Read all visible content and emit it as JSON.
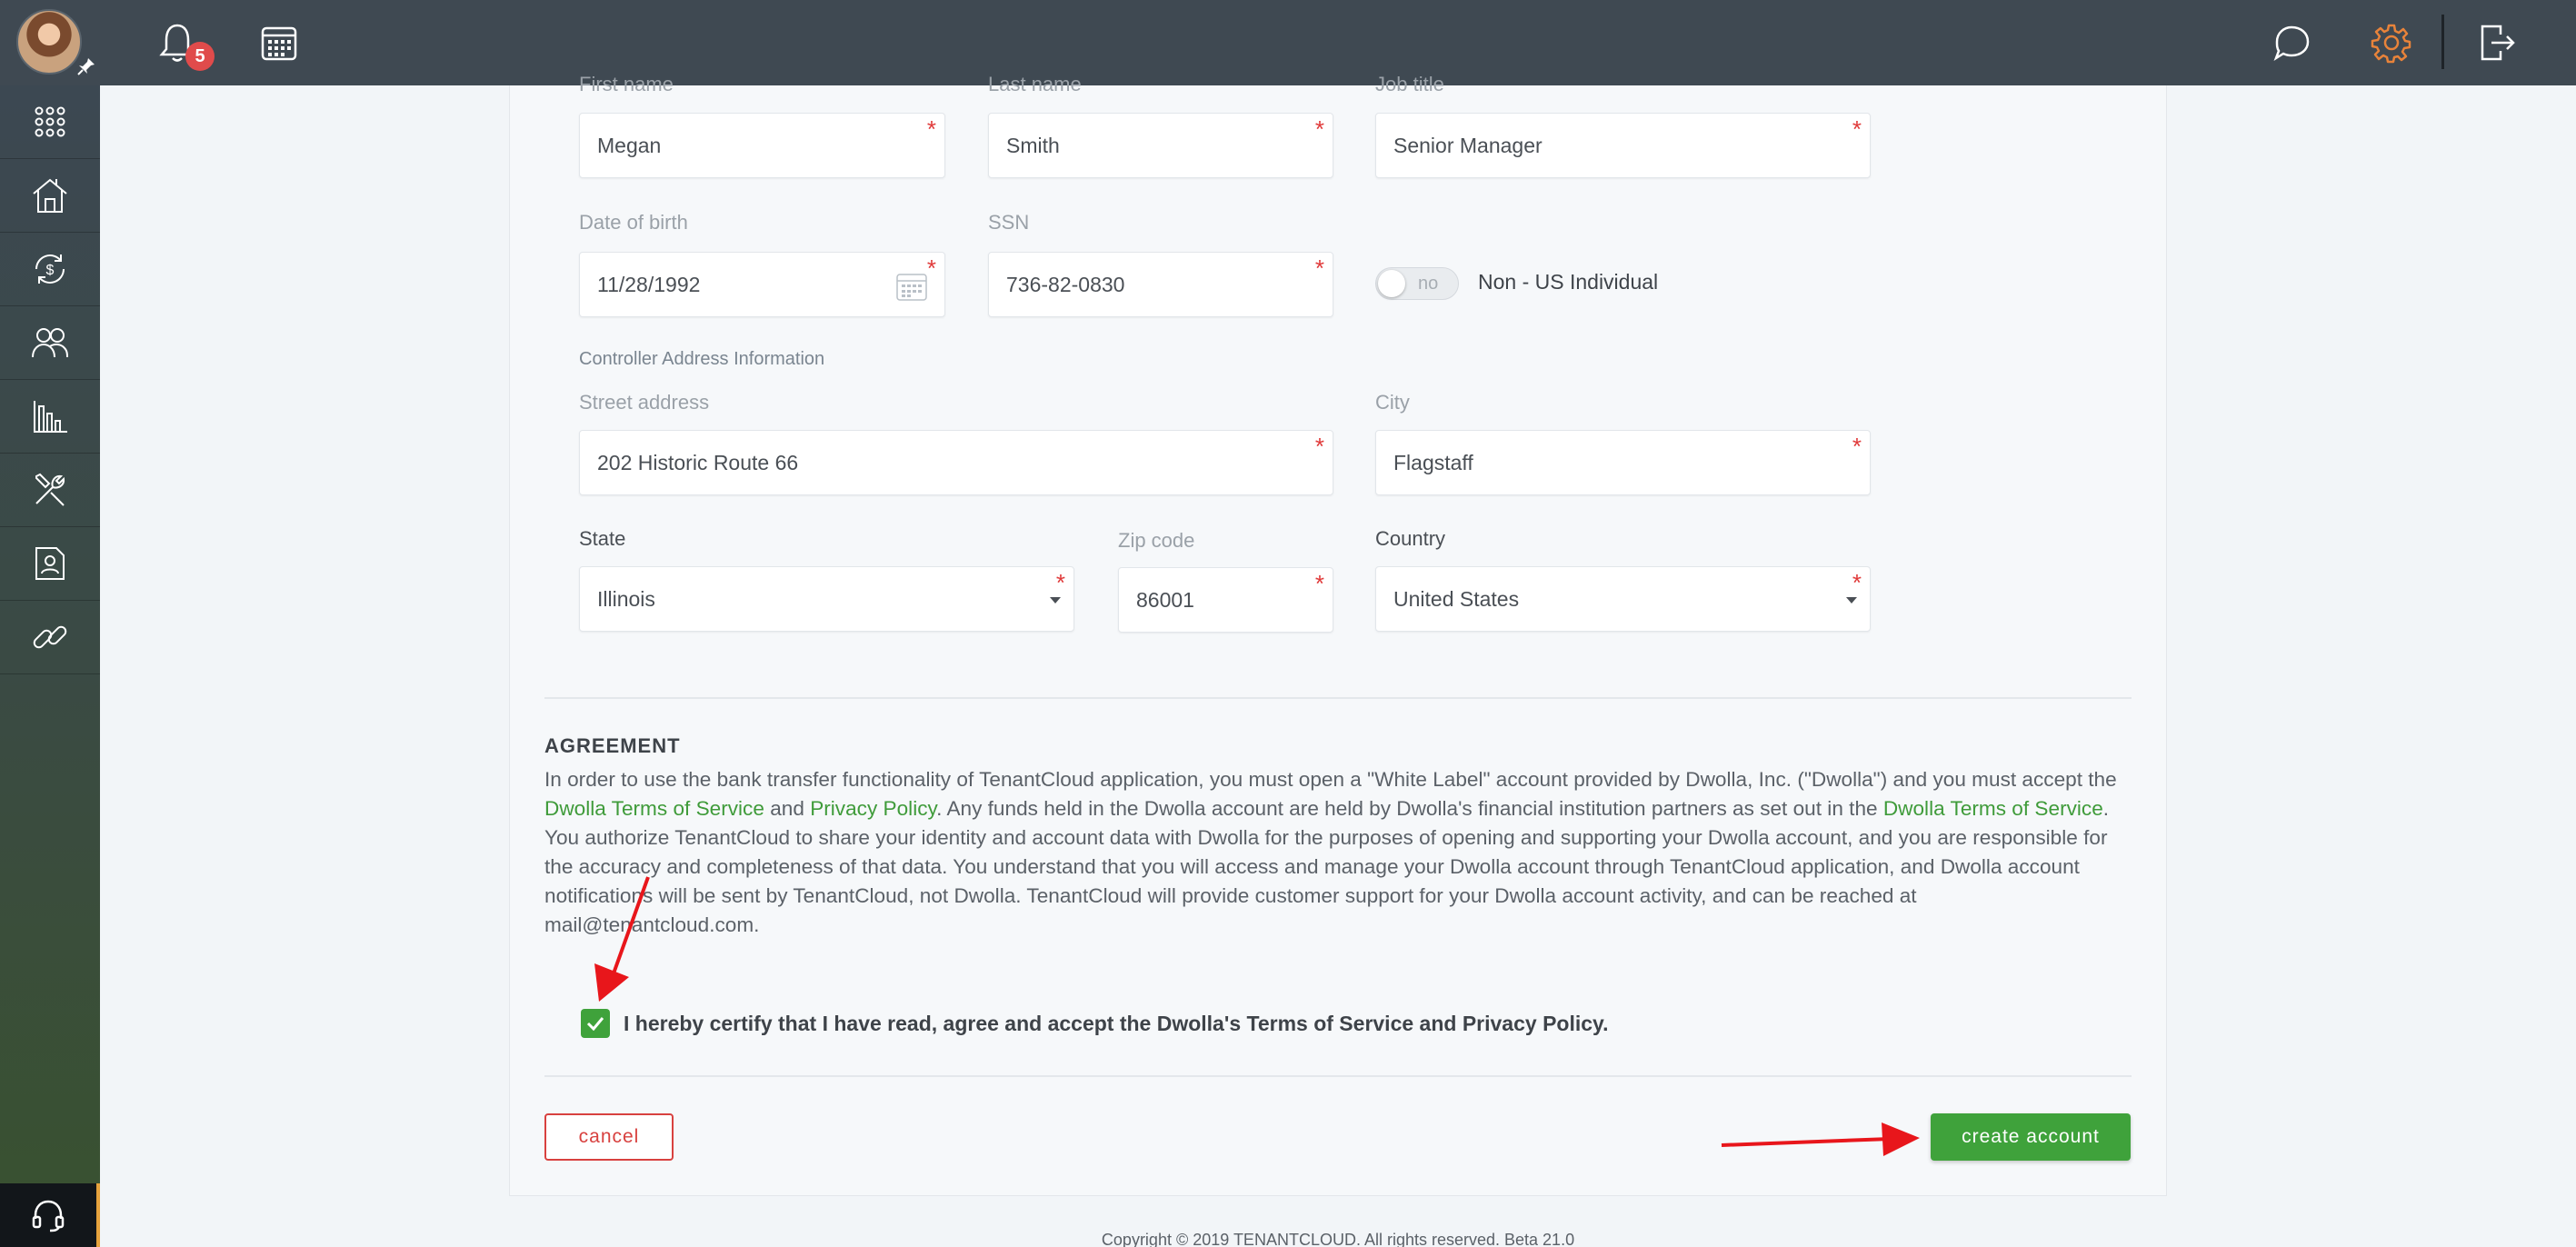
{
  "topbar": {
    "notification_count": "5",
    "icons": [
      "bell-icon",
      "calendar-icon",
      "chat-icon",
      "gear-icon",
      "logout-icon"
    ]
  },
  "sidebar": {
    "items": [
      "apps-icon",
      "properties-icon",
      "payments-icon",
      "people-icon",
      "reports-icon",
      "tools-icon",
      "documents-icon",
      "link-icon"
    ],
    "support_icon": "headset-icon"
  },
  "form": {
    "first_name": {
      "label": "First name",
      "value": "Megan"
    },
    "last_name": {
      "label": "Last name",
      "value": "Smith"
    },
    "job_title": {
      "label": "Job title",
      "value": "Senior Manager"
    },
    "dob": {
      "label": "Date of birth",
      "value": "11/28/1992"
    },
    "ssn": {
      "label": "SSN",
      "value": "736-82-0830"
    },
    "non_us": {
      "toggle_text": "no",
      "label": "Non - US Individual"
    },
    "section_title": "Controller Address Information",
    "street": {
      "label": "Street address",
      "value": "202 Historic Route 66"
    },
    "city": {
      "label": "City",
      "value": "Flagstaff"
    },
    "state": {
      "label": "State",
      "value": "Illinois"
    },
    "zip": {
      "label": "Zip code",
      "value": "86001"
    },
    "country": {
      "label": "Country",
      "value": "United States"
    }
  },
  "agreement": {
    "title": "AGREEMENT",
    "p1_a": "In order to use the bank transfer functionality of TenantCloud application, you must open a \"White Label\" account provided by Dwolla, Inc. (\"Dwolla\") and you must accept the ",
    "link_tos": "Dwolla Terms of Service",
    "p1_b": " and ",
    "link_privacy": "Privacy Policy",
    "p1_c": ". Any funds held in the Dwolla account are held by Dwolla's financial institution partners as set out in the ",
    "link_tos2": "Dwolla Terms of Service",
    "p1_d": ".",
    "p2": "You authorize TenantCloud to share your identity and account data with Dwolla for the purposes of opening and supporting your Dwolla account, and you are responsible for the accuracy and completeness of that data. You understand that you will access and manage your Dwolla account through TenantCloud application, and Dwolla account notifications will be sent by TenantCloud, not Dwolla. TenantCloud will provide customer support for your Dwolla account activity, and can be reached at mail@tenantcloud.com.",
    "certify": "I hereby certify that I have read, agree and accept the Dwolla's Terms of Service and Privacy Policy.",
    "certify_checked": true
  },
  "actions": {
    "cancel": "cancel",
    "create": "create account"
  },
  "footer": "Copyright © 2019 TENANTCLOUD. All rights reserved. Beta 21.0",
  "colors": {
    "accent_green": "#3fa23b",
    "danger_red": "#d8413f",
    "gear_orange": "#e8833a",
    "topbar": "#3f4952"
  }
}
